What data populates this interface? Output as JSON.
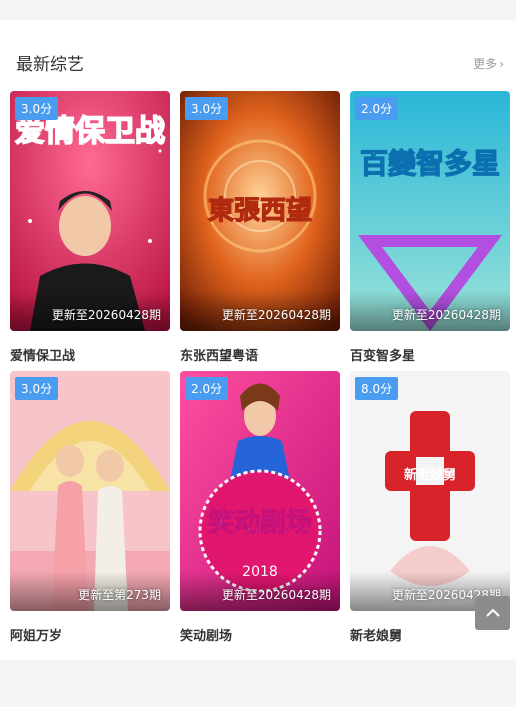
{
  "section": {
    "title": "最新综艺",
    "more_label": "更多"
  },
  "shows": [
    {
      "title": "爱情保卫战",
      "score": "3.0分",
      "update": "更新至20260428期",
      "poster_text": "爱情保卫战"
    },
    {
      "title": "东张西望粤语",
      "score": "3.0分",
      "update": "更新至20260428期",
      "poster_text": "東張西望"
    },
    {
      "title": "百变智多星",
      "score": "2.0分",
      "update": "更新至20260428期",
      "poster_text": "百變智多星"
    },
    {
      "title": "阿姐万岁",
      "score": "3.0分",
      "update": "更新至第273期",
      "poster_text": ""
    },
    {
      "title": "笑动剧场",
      "score": "2.0分",
      "update": "更新至20260428期",
      "poster_text": "笑动剧场",
      "poster_year": "2018"
    },
    {
      "title": "新老娘舅",
      "score": "8.0分",
      "update": "更新至20260428期",
      "poster_text": "新老娘舅"
    }
  ],
  "colors": {
    "score_badge": "#4a9cf0",
    "back_to_top": "#8c8c8c"
  },
  "icons": {
    "more": "chevron-right-icon",
    "back_to_top": "chevron-up-icon"
  }
}
